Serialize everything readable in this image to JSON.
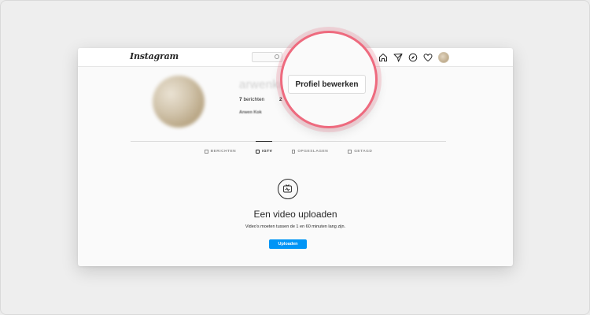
{
  "app": {
    "logo": "Instagram"
  },
  "profile": {
    "username": "arwenkok",
    "posts_count": "7",
    "posts_label": "berichten",
    "second_stat": "2",
    "full_name": "Arwen Kok",
    "edit_button_label": "Profiel bewerken"
  },
  "tabs": [
    {
      "label": "BERICHTEN",
      "icon": "grid-icon"
    },
    {
      "label": "IGTV",
      "icon": "igtv-icon"
    },
    {
      "label": "OPGESLAGEN",
      "icon": "bookmark-icon"
    },
    {
      "label": "GETAGD",
      "icon": "tag-icon"
    }
  ],
  "empty_state": {
    "title": "Een video uploaden",
    "subtitle": "Video's moeten tussen de 1 en 60 minuten lang zijn.",
    "button": "Uploaden"
  },
  "colors": {
    "accent": "#0095f6",
    "highlight": "#ee6a7e"
  }
}
